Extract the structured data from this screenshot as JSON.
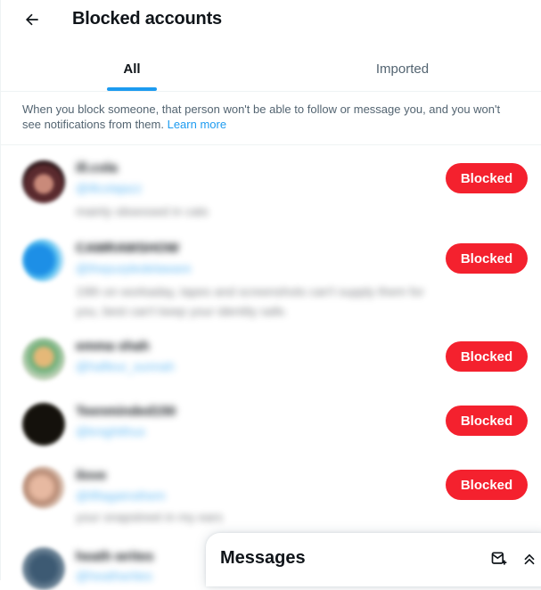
{
  "header": {
    "title": "Blocked accounts",
    "back_icon": "arrow-left-icon"
  },
  "tabs": [
    {
      "label": "All",
      "selected": true
    },
    {
      "label": "Imported",
      "selected": false
    }
  ],
  "notice": {
    "text": "When you block someone, that person won't be able to follow or message you, and you won't see notifications from them.",
    "link": "Learn more"
  },
  "colors": {
    "accent": "#1d9bf0",
    "blocked": "#f4212e",
    "text": "#0f1419",
    "muted": "#536471"
  },
  "accounts": [
    {
      "name": "ill.cola",
      "handle": "@illcolajazz",
      "bio": "mainly obsessed in cats",
      "button": "Blocked"
    },
    {
      "name": "CAMRAWSHOW",
      "handle": "@thepurpledelaware",
      "bio": "19th on workaday, tapes and screenshots can't supply them for you, best can't keep your identity safe.",
      "button": "Blocked"
    },
    {
      "name": "emma shah",
      "handle": "@hafleur_sunnah",
      "bio": "",
      "button": "Blocked"
    },
    {
      "name": "Teenminded150",
      "handle": "@knightthus",
      "bio": "",
      "button": "Blocked"
    },
    {
      "name": "ilove",
      "handle": "@liftagainsthem",
      "bio": "your snapstreet in my ears",
      "button": "Blocked"
    },
    {
      "name": "heath writes",
      "handle": "@heathwrites",
      "bio": "",
      "button": ""
    }
  ],
  "messages": {
    "title": "Messages",
    "compose_icon": "new-message-icon",
    "expand_icon": "chevrons-up-icon"
  }
}
